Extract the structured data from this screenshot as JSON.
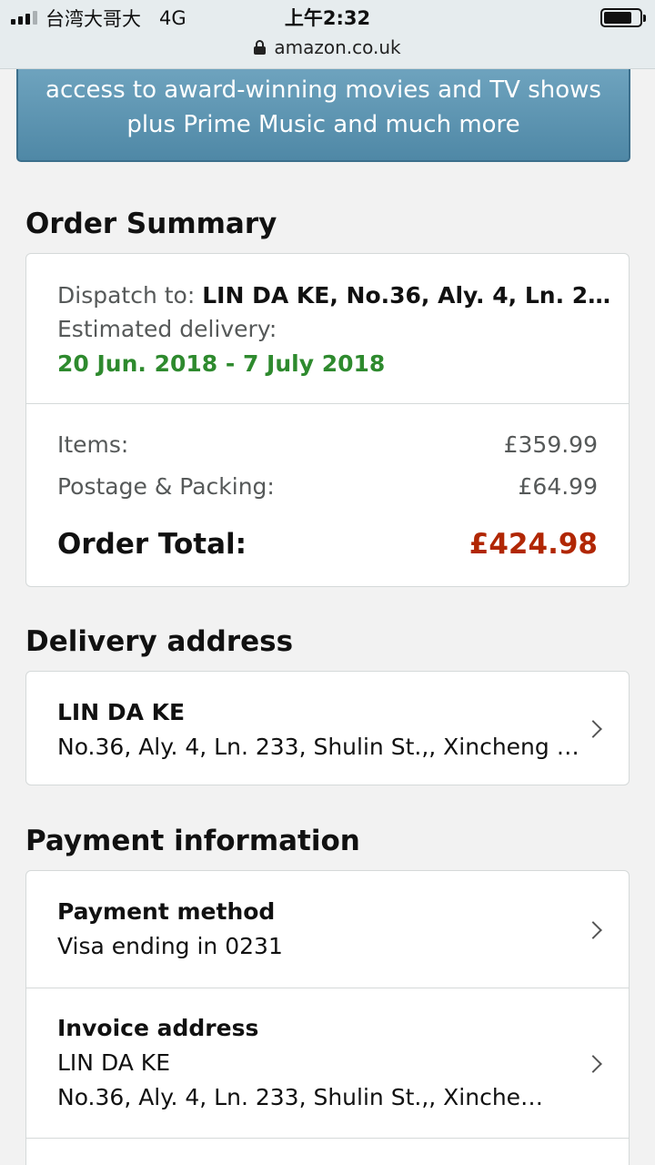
{
  "status_bar": {
    "carrier": "台湾大哥大",
    "network": "4G",
    "time": "上午2:32",
    "url": "amazon.co.uk"
  },
  "prime_banner": {
    "line1": "access to award-winning movies and TV shows",
    "line2": "plus Prime Music and much more"
  },
  "order_summary": {
    "title": "Order Summary",
    "dispatch_label": "Dispatch to:",
    "dispatch_value": "LIN DA KE, No.36, Aly. 4, Ln. 2…",
    "estimated_label": "Estimated delivery:",
    "estimated_value": "20 Jun. 2018 - 7 July 2018",
    "items_label": "Items:",
    "items_value": "£359.99",
    "postage_label": "Postage & Packing:",
    "postage_value": "£64.99",
    "total_label": "Order Total:",
    "total_value": "£424.98"
  },
  "delivery_address": {
    "title": "Delivery address",
    "name": "LIN DA KE",
    "address": "No.36, Aly. 4, Ln. 233, Shulin St.,, Xincheng …"
  },
  "payment_information": {
    "title": "Payment information",
    "method_label": "Payment method",
    "method_value": "Visa ending in 0231",
    "invoice_label": "Invoice address",
    "invoice_name": "LIN DA KE",
    "invoice_address": "No.36, Aly. 4, Ln. 233, Shulin St.,, Xinche…"
  },
  "colors": {
    "accent_green": "#2e8a2e",
    "total_red": "#b12704",
    "banner_blue": "#5b93b0"
  }
}
